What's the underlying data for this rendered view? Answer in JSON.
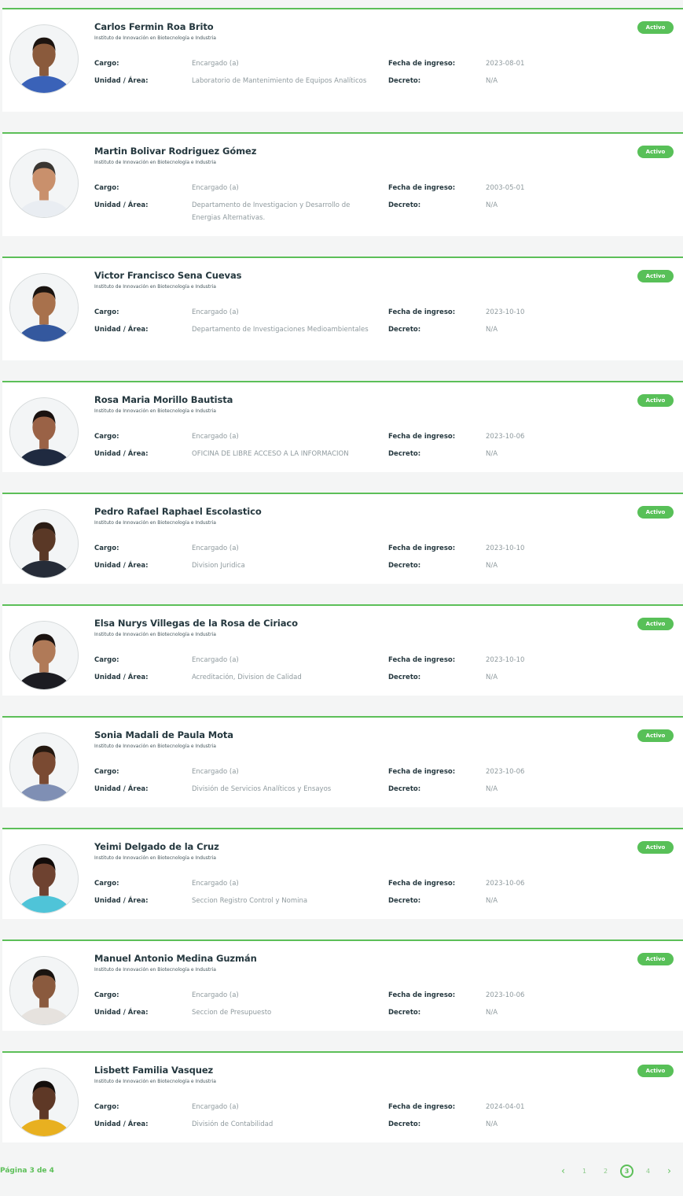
{
  "labels": {
    "cargo": "Cargo:",
    "unidad": "Unidad / Área:",
    "fecha": "Fecha de ingreso:",
    "decreto": "Decreto:"
  },
  "employees": [
    {
      "name": "Carlos Fermin Roa Brito",
      "institution": "Instituto de Innovación en Biotecnología e Industria",
      "cargo": "Encargado (a)",
      "unidad": "Laboratorio de Mantenimiento de Equipos Analíticos",
      "fecha": "2023-08-01",
      "decreto": "N/A",
      "status": "Activo",
      "attire": "#3a62b8",
      "skin": "#8a5a3c",
      "hair": "#1c1410"
    },
    {
      "name": "Martin Bolivar Rodriguez Gómez",
      "institution": "Instituto de Innovación en Biotecnología e Industria",
      "cargo": "Encargado (a)",
      "unidad": "Departamento de Investigacion y Desarrollo de Energias Alternativas.",
      "fecha": "2003-05-01",
      "decreto": "N/A",
      "status": "Activo",
      "attire": "#e9edf2",
      "skin": "#c9906c",
      "hair": "#3a3632"
    },
    {
      "name": "Victor Francisco Sena Cuevas",
      "institution": "Instituto de Innovación en Biotecnología e Industria",
      "cargo": "Encargado (a)",
      "unidad": "Departamento de Investigaciones Medioambientales",
      "fecha": "2023-10-10",
      "decreto": "N/A",
      "status": "Activo",
      "attire": "#34589e",
      "skin": "#a8714c",
      "hair": "#1a1410"
    },
    {
      "name": "Rosa Maria Morillo Bautista",
      "institution": "Instituto de Innovación en Biotecnología e Industria",
      "cargo": "Encargado (a)",
      "unidad": "OFICINA DE LIBRE ACCESO A LA INFORMACION",
      "fecha": "2023-10-06",
      "decreto": "N/A",
      "status": "Activo",
      "attire": "#1f2a40",
      "skin": "#9a6246",
      "hair": "#1a1210"
    },
    {
      "name": "Pedro Rafael Raphael Escolastico",
      "institution": "Instituto de Innovación en Biotecnología e Industria",
      "cargo": "Encargado (a)",
      "unidad": "Division Juridica",
      "fecha": "2023-10-10",
      "decreto": "N/A",
      "status": "Activo",
      "attire": "#262c38",
      "skin": "#5a3826",
      "hair": "#2a1c14"
    },
    {
      "name": "Elsa Nurys Villegas de la Rosa de Ciriaco",
      "institution": "Instituto de Innovación en Biotecnología e Industria",
      "cargo": "Encargado (a)",
      "unidad": "Acreditación, Division de Calidad",
      "fecha": "2023-10-10",
      "decreto": "N/A",
      "status": "Activo",
      "attire": "#1c1c22",
      "skin": "#b07a58",
      "hair": "#1a1210"
    },
    {
      "name": "Sonia Madali de Paula Mota",
      "institution": "Instituto de Innovación en Biotecnología e Industria",
      "cargo": "Encargado (a)",
      "unidad": "División de Servicios Analíticos y Ensayos",
      "fecha": "2023-10-06",
      "decreto": "N/A",
      "status": "Activo",
      "attire": "#7f8fb4",
      "skin": "#7a4a32",
      "hair": "#241810"
    },
    {
      "name": "Yeimi Delgado de la Cruz",
      "institution": "Instituto de Innovación en Biotecnología e Industria",
      "cargo": "Encargado (a)",
      "unidad": "Seccion Registro Control y Nomina",
      "fecha": "2023-10-06",
      "decreto": "N/A",
      "status": "Activo",
      "attire": "#4fc4d8",
      "skin": "#6e4230",
      "hair": "#120c0a"
    },
    {
      "name": "Manuel Antonio Medina Guzmán",
      "institution": "Instituto de Innovación en Biotecnología e Industria",
      "cargo": "Encargado (a)",
      "unidad": "Seccion de Presupuesto",
      "fecha": "2023-10-06",
      "decreto": "N/A",
      "status": "Activo",
      "attire": "#e6e2de",
      "skin": "#8a5a3e",
      "hair": "#1a1410"
    },
    {
      "name": "Lisbett Familia Vasquez",
      "institution": "Instituto de Innovación en Biotecnología e Industria",
      "cargo": "Encargado (a)",
      "unidad": "División de Contabilidad",
      "fecha": "2024-04-01",
      "decreto": "N/A",
      "status": "Activo",
      "attire": "#e8b020",
      "skin": "#5e3826",
      "hair": "#140e0c"
    }
  ],
  "pagination": {
    "label": "Página 3 de 4",
    "prev": "‹",
    "next": "›",
    "pages": [
      "1",
      "2",
      "3",
      "4"
    ],
    "current": "3"
  }
}
